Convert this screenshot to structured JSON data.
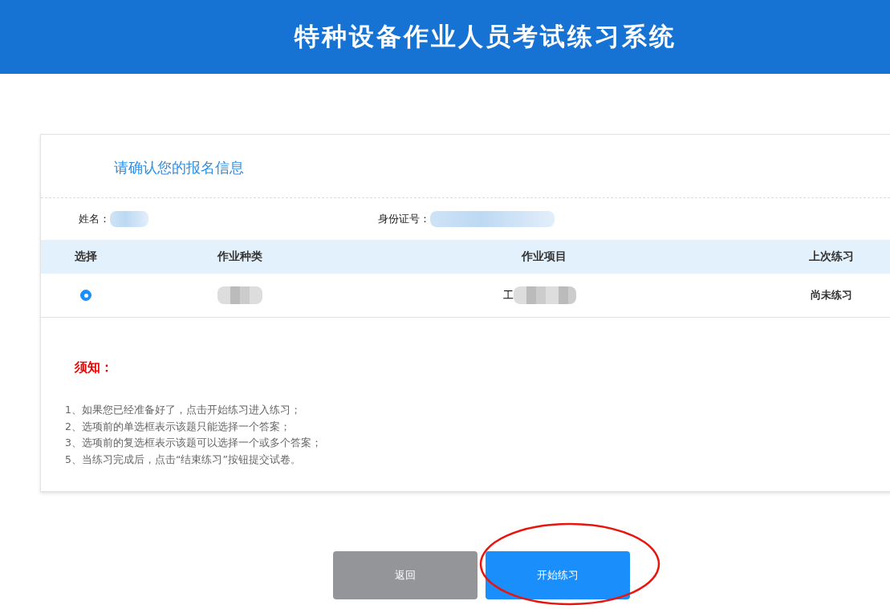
{
  "header": {
    "title": "特种设备作业人员考试练习系统"
  },
  "card": {
    "title": "请确认您的报名信息",
    "info": [
      {
        "label": "姓名：",
        "redacted": true
      },
      {
        "label": "身份证号：",
        "redacted": true
      }
    ],
    "table": {
      "columns": [
        "选择",
        "作业种类",
        "作业项目",
        "上次练习"
      ],
      "rows": [
        {
          "selected": true,
          "category": {
            "redacted": true
          },
          "project": {
            "text": "工",
            "redacted": true
          },
          "last": "尚未练习"
        }
      ]
    },
    "notice": {
      "title": "须知：",
      "items": [
        "1、如果您已经准备好了，点击开始练习进入练习；",
        "2、选项前的单选框表示该题只能选择一个答案；",
        "3、选项前的复选框表示该题可以选择一个或多个答案；",
        "5、当练习完成后，点击“结束练习”按钮提交试卷。"
      ]
    }
  },
  "buttons": [
    {
      "label": "返回",
      "kind": "secondary"
    },
    {
      "label": "开始练习",
      "kind": "primary",
      "circled": true
    }
  ]
}
